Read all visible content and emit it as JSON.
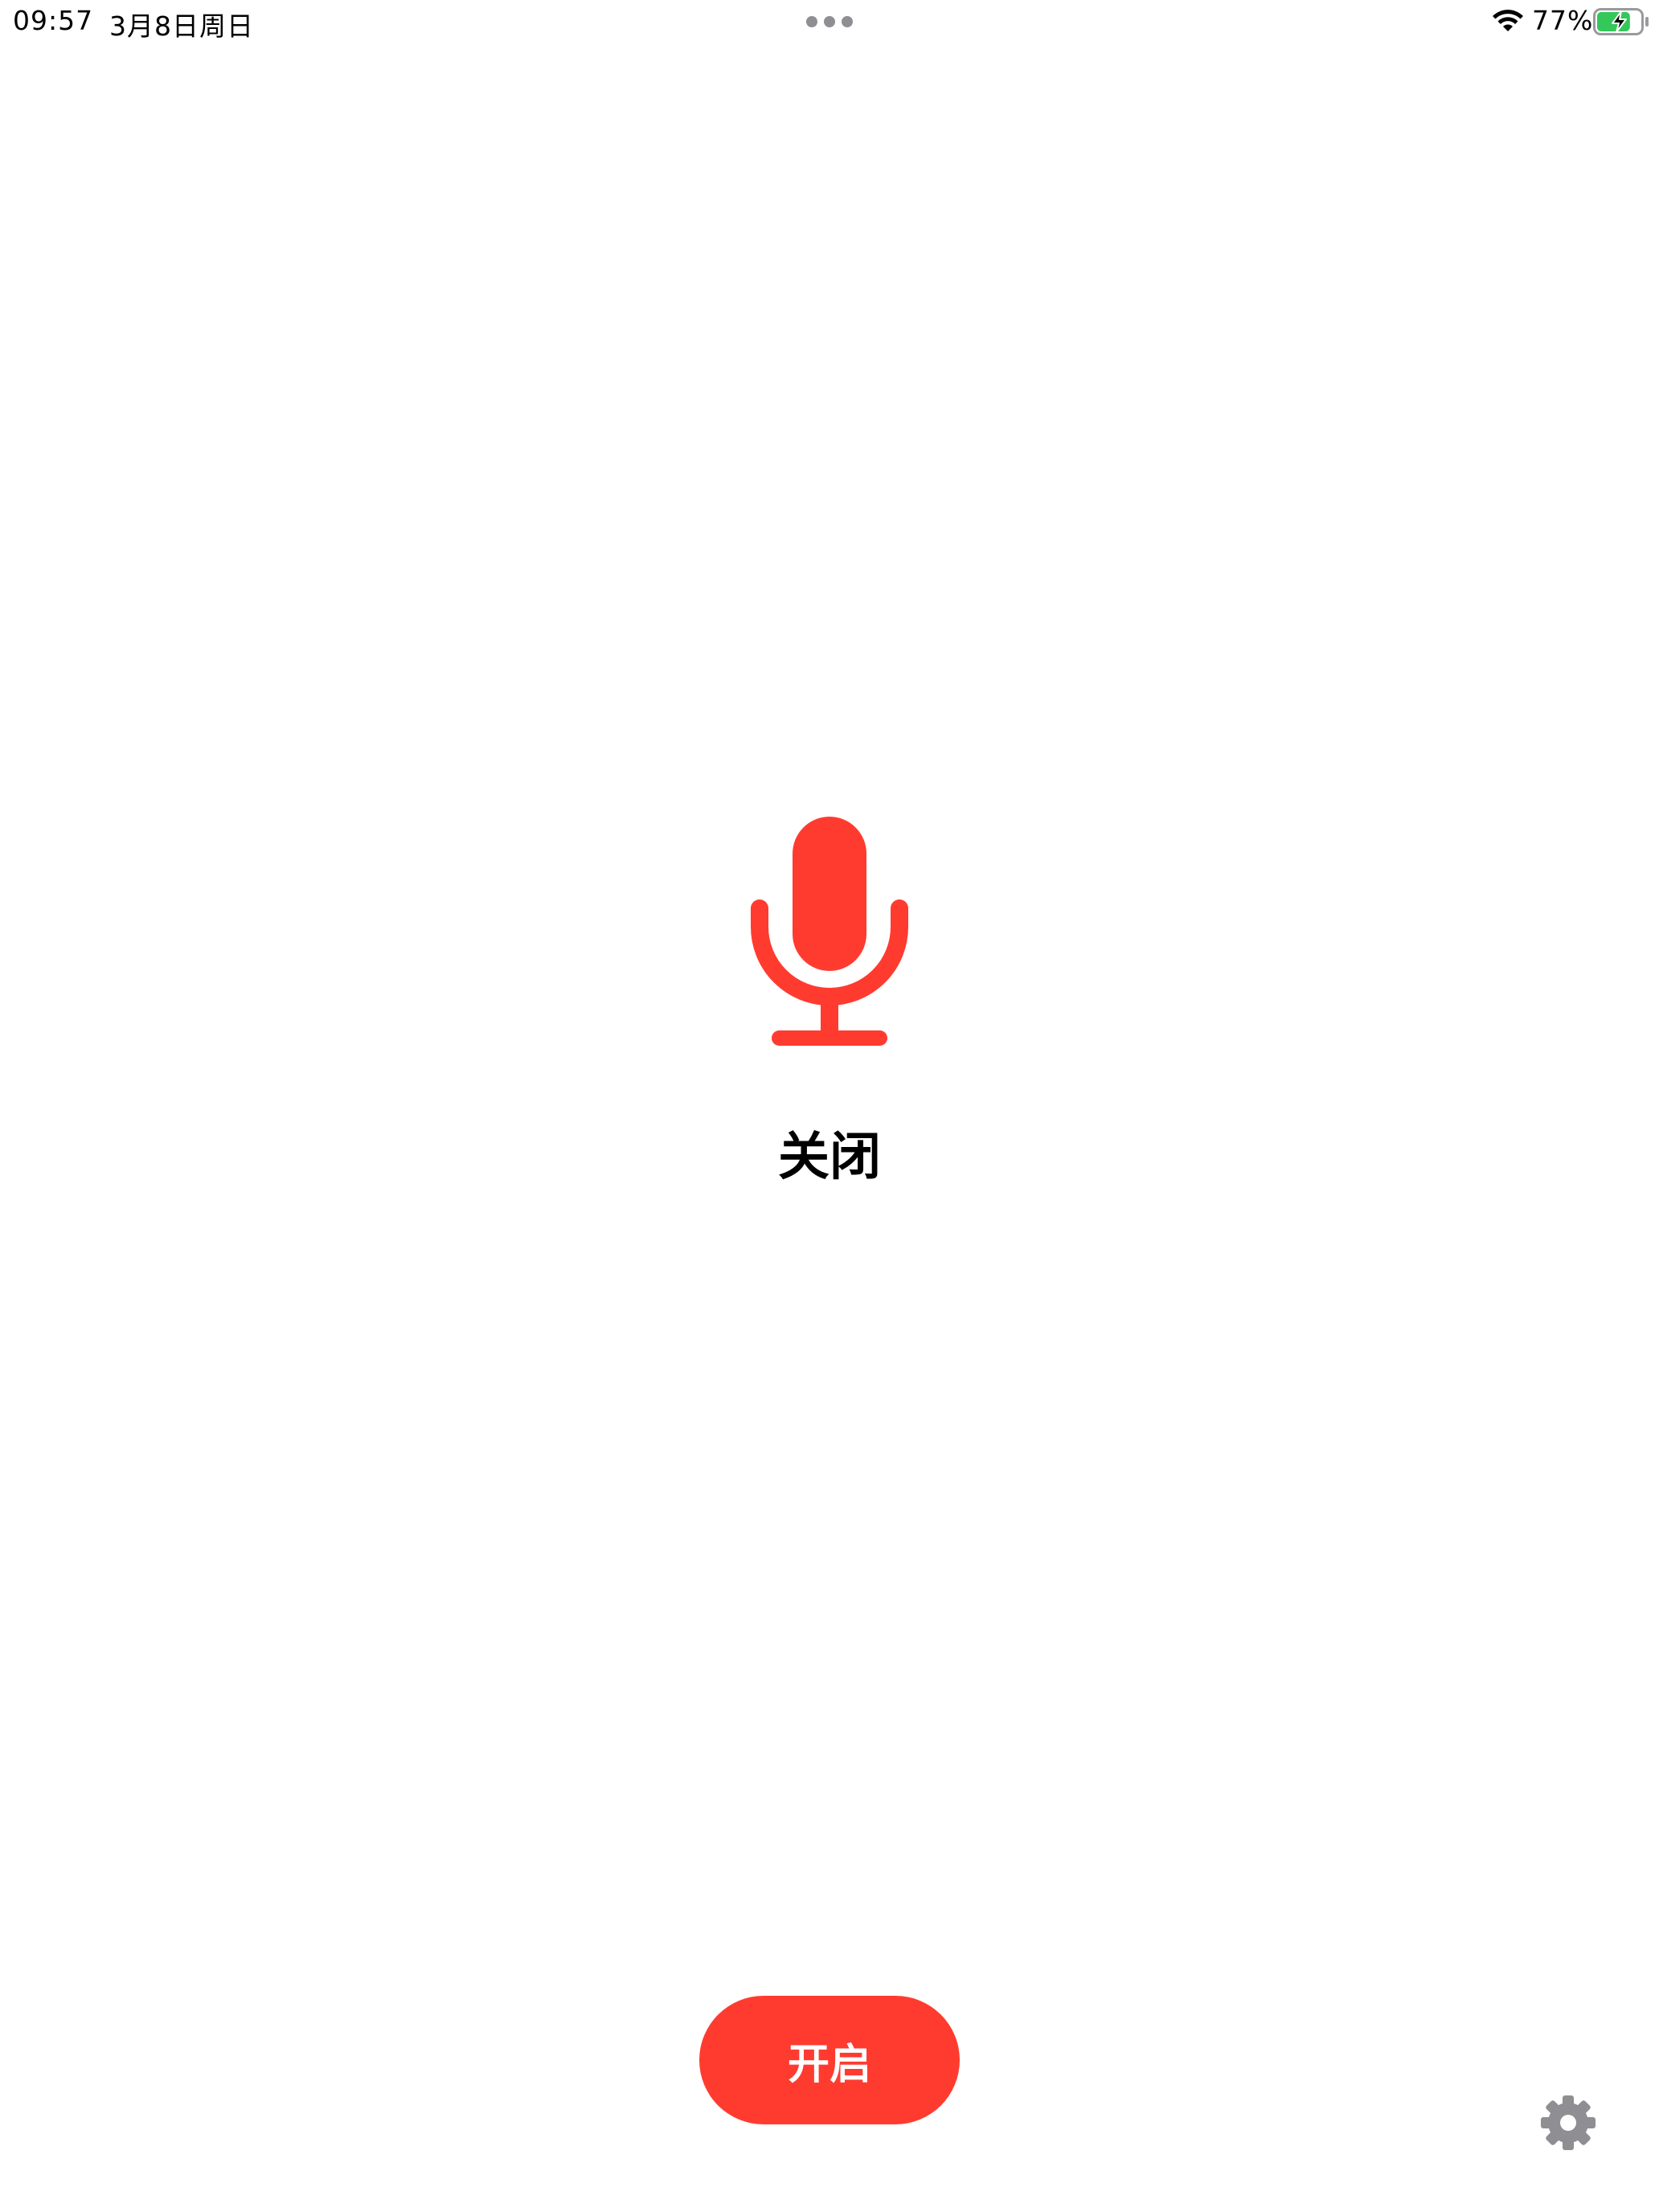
{
  "status_bar": {
    "time": "09:57",
    "date": "3月8日周日",
    "battery_percent": "77%",
    "battery_level": 0.77,
    "charging": true,
    "icons": [
      "multitask-dots-icon",
      "wifi-icon",
      "battery-charging-icon"
    ]
  },
  "main": {
    "mic_icon": "microphone-icon",
    "state_label": "关闭",
    "toggle_label": "开启",
    "settings_icon": "gear-icon"
  },
  "colors": {
    "accent": "#ff3b30",
    "battery_fill": "#34c759",
    "icon_gray": "#8e8e93",
    "text": "#000000",
    "background": "#ffffff"
  }
}
